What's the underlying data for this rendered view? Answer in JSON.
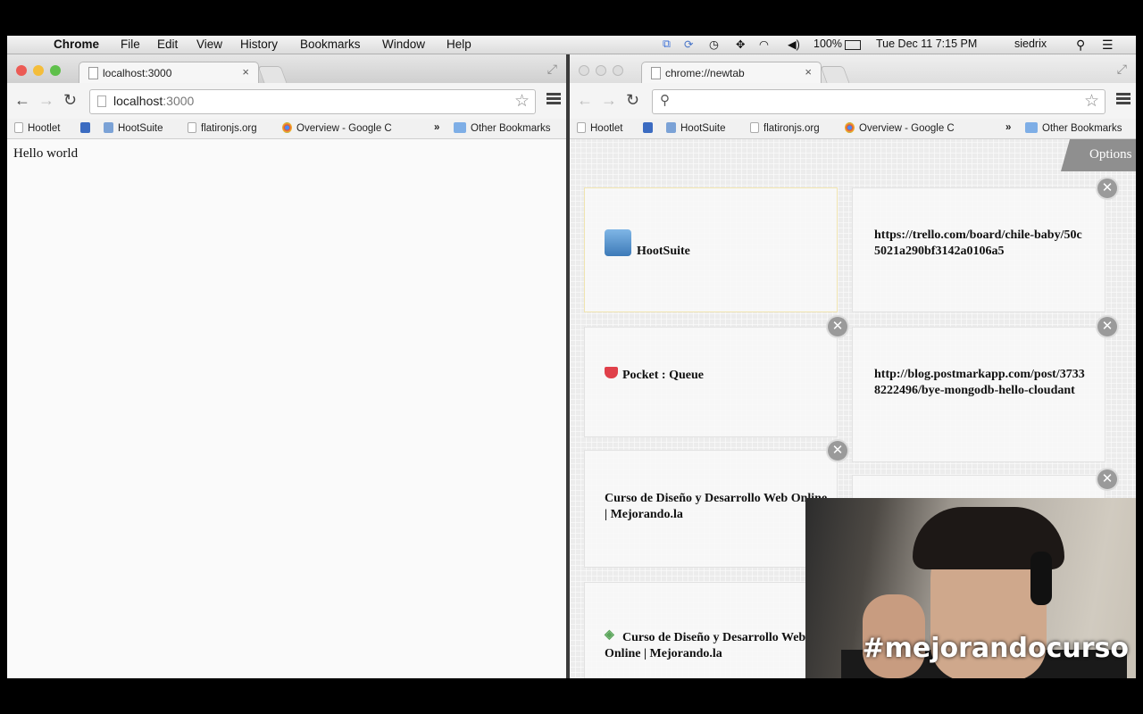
{
  "menubar": {
    "app_name": "Chrome",
    "menus": [
      "File",
      "Edit",
      "View",
      "History",
      "Bookmarks",
      "Window",
      "Help"
    ],
    "battery": "100%",
    "clock": "Tue Dec 11  7:15 PM",
    "user": "siedrix"
  },
  "left_browser": {
    "tab_title": "localhost:3000",
    "tab_close": "×",
    "url_host": "localhost",
    "url_port": ":3000",
    "bookmarks": [
      "Hootlet",
      "HootSuite",
      "flatironjs.org",
      "Overview - Google C"
    ],
    "bookmarks_overflow": "»",
    "other_bookmarks": "Other Bookmarks",
    "page_text": "Hello world"
  },
  "right_browser": {
    "tab_title": "chrome://newtab",
    "tab_close": "×",
    "url": "",
    "bookmarks": [
      "Hootlet",
      "HootSuite",
      "flatironjs.org",
      "Overview - Google C"
    ],
    "bookmarks_overflow": "»",
    "other_bookmarks": "Other Bookmarks",
    "options_label": "Options",
    "tiles": [
      {
        "title": "HootSuite"
      },
      {
        "title": "https://trello.com/board/chile-baby/50c5021a290bf3142a0106a5"
      },
      {
        "title": "Pocket : Queue"
      },
      {
        "title": "http://blog.postmarkapp.com/post/37338222496/bye-mongodb-hello-cloudant"
      },
      {
        "title": "Curso de Diseño y Desarrollo Web Online | Mejorando.la"
      },
      {
        "title": "Curso de Diseño y Desarrollo Web Online | Mejorando.la"
      }
    ],
    "close_glyph": "✕"
  },
  "webcam": {
    "overlay_text": "#mejorandocurso"
  },
  "colors": {
    "options_bg": "#8f8f8f",
    "pocket_red": "#e0404a",
    "chrome_logo": "#dd4b39"
  }
}
